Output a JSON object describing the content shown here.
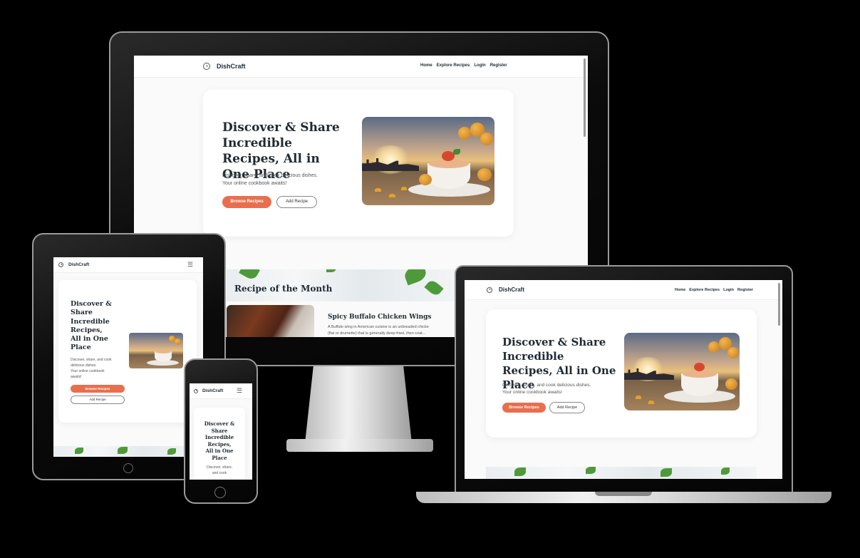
{
  "brand": "DishCraft",
  "nav": {
    "home": "Home",
    "explore": "Explore Recipes",
    "login": "Login",
    "register": "Register"
  },
  "hero": {
    "title": "Discover & Share Incredible Recipes, All in One Place",
    "subtitle_line1": "Discover, share, and cook delicious dishes.",
    "subtitle_line2": "Your online cookbook awaits!",
    "browse_button": "Browse Recipes",
    "add_button": "Add Recipe"
  },
  "tablet_hero": {
    "title_lines": [
      "Discover &",
      "Share",
      "Incredible",
      "Recipes,",
      "All in One",
      "Place"
    ],
    "subtitle_lines": [
      "Discover, share, and cook",
      "delicious dishes.",
      "Your online cookbook",
      "awaits!"
    ]
  },
  "phone_hero": {
    "title_lines": [
      "Discover &",
      "Share",
      "Incredible",
      "Recipes,",
      "All in One",
      "Place"
    ],
    "subtitle_lines": [
      "Discover, share,",
      "and cook"
    ]
  },
  "recipe_of_month": {
    "heading": "Recipe of the Month",
    "name": "Spicy Buffalo Chicken Wings",
    "desc_line1": "A Buffalo wing in American cuisine is an unbreaded chicke",
    "desc_line2": "(flat or drumette) that is generally deep-fried, then coat..."
  },
  "icons": {
    "logo": "compass-logo-icon",
    "menu": "hamburger-menu-icon"
  },
  "colors": {
    "accent": "#e86f4e",
    "text": "#1f2a33",
    "background": "#000000"
  }
}
